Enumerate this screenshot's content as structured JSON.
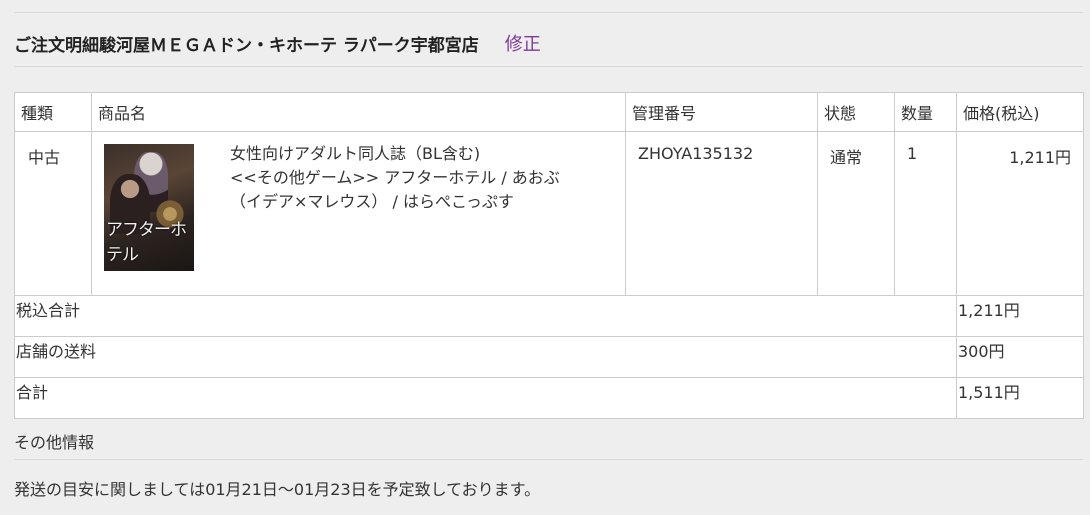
{
  "header": {
    "shop_title": "ご注文明細駿河屋ＭＥＧＡドン・キホーテ ラパーク宇都宮店",
    "edit_label": "修正"
  },
  "table": {
    "columns": {
      "type": "種類",
      "product": "商品名",
      "code": "管理番号",
      "status": "状態",
      "qty": "数量",
      "price": "価格(税込)"
    },
    "item": {
      "type": "中古",
      "product_line1": "女性向けアダルト同人誌（BL含む)",
      "product_line2": "<<その他ゲーム>> アフターホテル / あおぶ",
      "product_line3": "（イデア×マレウス） / はらぺこっぷす",
      "cover_text": "アフターホテル",
      "code": "ZHOYA135132",
      "status": "通常",
      "qty": "1",
      "price": "1,211円"
    },
    "summary": {
      "subtotal_label": "税込合計",
      "subtotal_value": "1,211円",
      "shipping_label": "店舗の送料",
      "shipping_value": "300円",
      "total_label": "合計",
      "total_value": "1,511円"
    }
  },
  "other": {
    "title": "その他情報",
    "shipping_note": "発送の目安に関しましては01月21日～01月23日を予定致しております。"
  },
  "colors": {
    "background": "#eeeeee",
    "link": "#7a3a98",
    "border": "#cccccc"
  }
}
